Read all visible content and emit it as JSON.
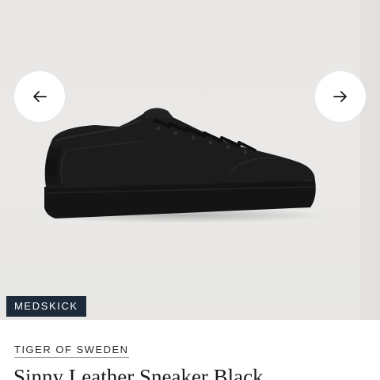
{
  "product": {
    "badge": "MEDSKICK",
    "brand": "TIGER OF SWEDEN",
    "name": "Sinny Leather Sneaker Black"
  },
  "gallery": {
    "prev_icon": "arrow-left-icon",
    "next_icon": "arrow-right-icon",
    "image": "black suede sneaker"
  },
  "colors": {
    "background": "#eae9e7",
    "badge_bg": "#1c2a3a",
    "shoe": "#1b1b1b"
  }
}
